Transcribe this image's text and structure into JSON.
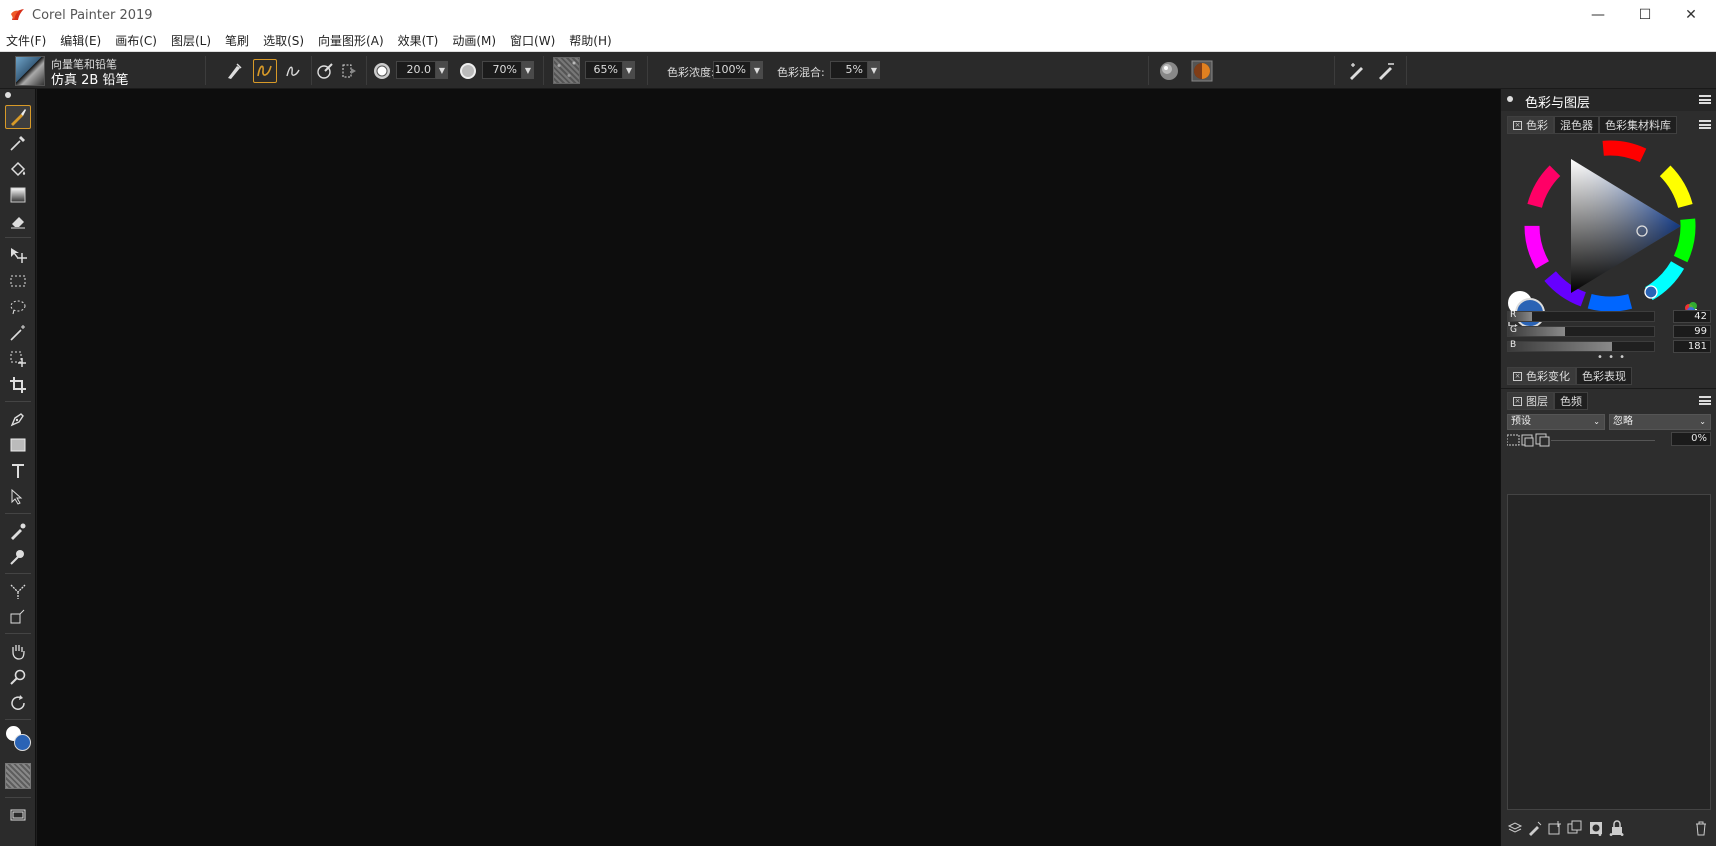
{
  "app": {
    "title": "Corel Painter 2019",
    "window_controls": {
      "minimize": "—",
      "maximize": "☐",
      "close": "✕"
    }
  },
  "menu": [
    "文件(F)",
    "编辑(E)",
    "画布(C)",
    "图层(L)",
    "笔刷",
    "选取(S)",
    "向量图形(A)",
    "效果(T)",
    "动画(M)",
    "窗口(W)",
    "帮助(H)"
  ],
  "propbar": {
    "brush_category": "向量笔和铅笔",
    "brush_variant": "仿真 2B 铅笔",
    "size_value": "20.0",
    "opacity_value": "70%",
    "grain_value": "65%",
    "color_concentration_label": "色彩浓度:",
    "color_concentration_value": "100%",
    "color_mix_label": "色彩混合:",
    "color_mix_value": "5%"
  },
  "panel": {
    "title": "色彩与图层",
    "color_tabs": [
      "色彩",
      "混色器",
      "色彩集材料库"
    ],
    "rgb": [
      {
        "label": "R",
        "value": "42",
        "fraction": 0.165
      },
      {
        "label": "G",
        "value": "99",
        "fraction": 0.388
      },
      {
        "label": "B",
        "value": "181",
        "fraction": 0.71
      }
    ],
    "more": "• • •",
    "color_variation_tabs": [
      "色彩变化",
      "色彩表现"
    ],
    "layer_tabs": [
      "图层",
      "色频"
    ],
    "composite_method": "预设",
    "composite_depth": "忽略",
    "layer_opacity": "0%",
    "layer_more": "• • •"
  },
  "colors": {
    "main_color": "#2a63b5",
    "secondary_color": "#ffffff",
    "accent": "#d89a28",
    "canvas_bg": "#0d0d0d"
  },
  "tools": [
    "brush-icon",
    "dropper-icon",
    "paint-bucket-icon",
    "gradient-icon",
    "eraser-icon",
    "layer-adjuster-icon",
    "rectangle-select-icon",
    "lasso-icon",
    "magic-wand-icon",
    "transform-icon",
    "crop-icon",
    "pen-icon",
    "rectangle-shape-icon",
    "text-icon",
    "shape-selection-icon",
    "cloner-icon",
    "rubber-stamp-icon",
    "perspective-guide-icon",
    "divine-proportion-icon",
    "grabber-icon",
    "magnifier-icon",
    "rotate-page-icon"
  ]
}
